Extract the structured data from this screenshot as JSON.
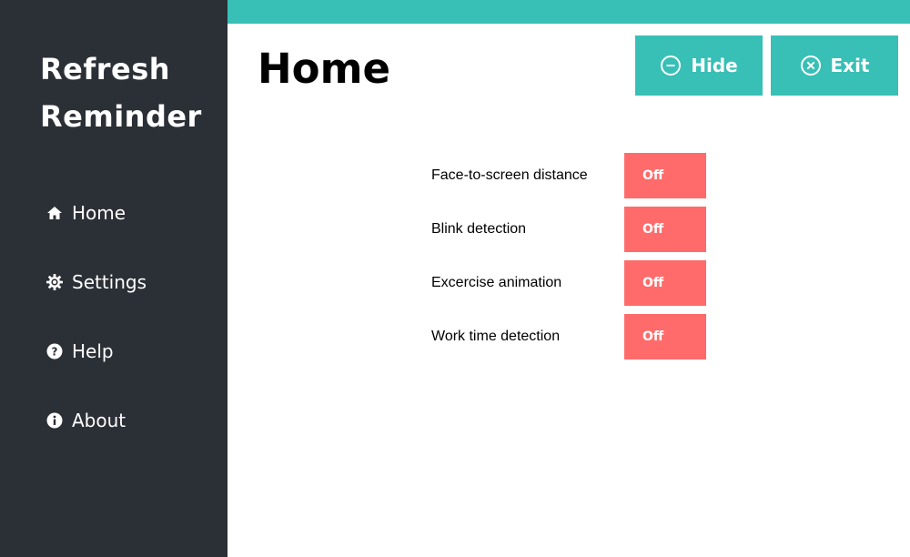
{
  "sidebar": {
    "app_title_line1": "Refresh",
    "app_title_line2": "Reminder",
    "items": [
      {
        "label": "Home",
        "icon": "home-icon"
      },
      {
        "label": "Settings",
        "icon": "gear-icon"
      },
      {
        "label": "Help",
        "icon": "question-circle-icon"
      },
      {
        "label": "About",
        "icon": "info-circle-icon"
      }
    ]
  },
  "header": {
    "title": "Home",
    "hide_label": "Hide",
    "exit_label": "Exit"
  },
  "features": [
    {
      "label": "Face-to-screen distance",
      "state": "Off"
    },
    {
      "label": "Blink detection",
      "state": "Off"
    },
    {
      "label": "Excercise animation",
      "state": "Off"
    },
    {
      "label": "Work time detection",
      "state": "Off"
    }
  ],
  "colors": {
    "sidebar_bg": "#2b2f36",
    "accent": "#38bfb6",
    "toggle_off": "#ff6b6b"
  }
}
